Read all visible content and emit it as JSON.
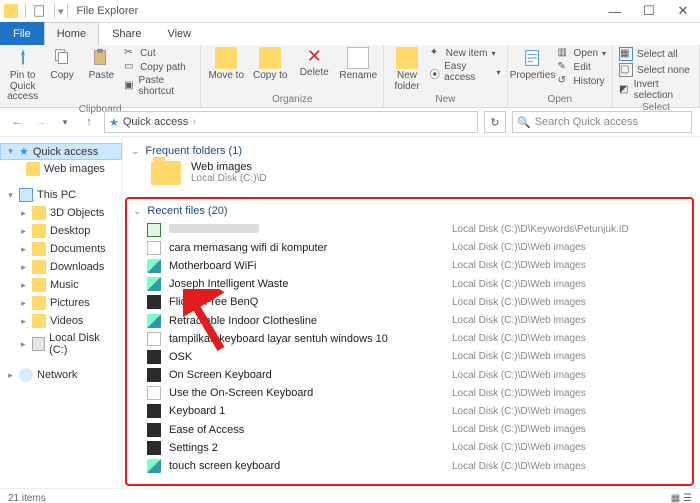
{
  "title": "File Explorer",
  "tabs": {
    "file": "File",
    "home": "Home",
    "share": "Share",
    "view": "View"
  },
  "ribbon": {
    "clipboard": {
      "pin": "Pin to Quick\naccess",
      "copy": "Copy",
      "paste": "Paste",
      "cut": "Cut",
      "copypath": "Copy path",
      "pasteshortcut": "Paste shortcut",
      "label": "Clipboard"
    },
    "organize": {
      "move": "Move\nto",
      "copyTo": "Copy\nto",
      "del": "Delete",
      "rename": "Rename",
      "label": "Organize"
    },
    "new": {
      "folder": "New\nfolder",
      "newitem": "New item",
      "easyaccess": "Easy access",
      "label": "New"
    },
    "open": {
      "prop": "Properties",
      "open": "Open",
      "edit": "Edit",
      "history": "History",
      "label": "Open"
    },
    "select": {
      "all": "Select all",
      "none": "Select none",
      "invert": "Invert selection",
      "label": "Select"
    }
  },
  "address": {
    "location": "Quick access",
    "searchPlaceholder": "Search Quick access"
  },
  "sidebar": {
    "quick": {
      "label": "Quick access"
    },
    "webimages": "Web images",
    "thispc": "This PC",
    "items": [
      "3D Objects",
      "Desktop",
      "Documents",
      "Downloads",
      "Music",
      "Pictures",
      "Videos",
      "Local Disk (C:)"
    ],
    "network": "Network"
  },
  "frequent": {
    "header": "Frequent folders (1)",
    "folder": {
      "name": "Web images",
      "path": "Local Disk (C:)\\D"
    }
  },
  "recent": {
    "header": "Recent files (20)",
    "pathCommon": "Local Disk (C:)\\D\\Web images",
    "pathAlt": "Local Disk (C:)\\D\\Keywords\\Petunjuk.ID",
    "files": [
      {
        "name": "",
        "icon": "xls",
        "path": "alt",
        "blur": true
      },
      {
        "name": "cara memasang wifi di komputer",
        "icon": "file"
      },
      {
        "name": "Motherboard WiFi",
        "icon": "img"
      },
      {
        "name": "Joseph Intelligent Waste",
        "icon": "img"
      },
      {
        "name": "Flicker Free BenQ",
        "icon": "dark"
      },
      {
        "name": "Retractable Indoor Clothesline",
        "icon": "img"
      },
      {
        "name": "tampilkan keyboard layar sentuh windows 10",
        "icon": "file"
      },
      {
        "name": "OSK",
        "icon": "dark"
      },
      {
        "name": "On Screen Keyboard",
        "icon": "dark"
      },
      {
        "name": "Use the On-Screen Keyboard",
        "icon": "file"
      },
      {
        "name": "Keyboard 1",
        "icon": "dark"
      },
      {
        "name": "Ease of Access",
        "icon": "dark"
      },
      {
        "name": "Settings 2",
        "icon": "dark"
      },
      {
        "name": "touch screen keyboard",
        "icon": "img"
      }
    ]
  },
  "status": {
    "items": "21 items"
  }
}
